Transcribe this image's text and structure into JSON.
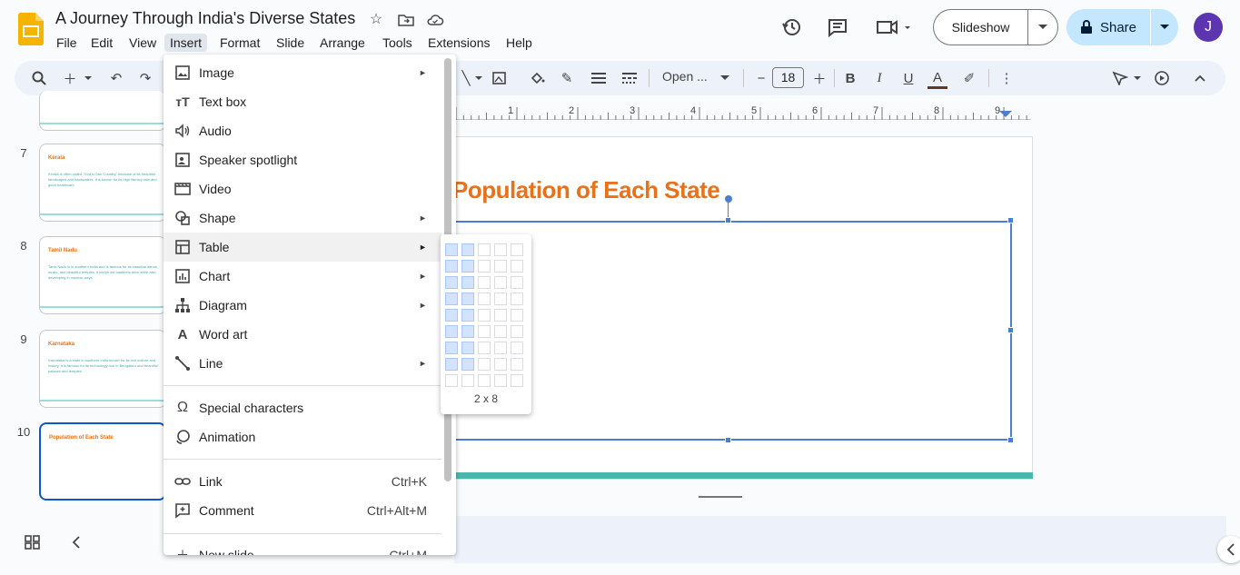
{
  "app": {
    "doc_title": "A Journey Through India's Diverse States",
    "menus": [
      "File",
      "Edit",
      "View",
      "Insert",
      "Format",
      "Slide",
      "Arrange",
      "Tools",
      "Extensions",
      "Help"
    ],
    "active_menu": "Insert",
    "slideshow_label": "Slideshow",
    "share_label": "Share",
    "avatar_initial": "J"
  },
  "toolbar": {
    "font_name": "Open ...",
    "font_size": "18"
  },
  "filmstrip": {
    "slides": [
      {
        "num": "7",
        "title": "Kerala",
        "body": "Kerala is often called \"God's Own Country\" because of its beautiful landscapes and backwaters. It is known for its high literacy rate and good healthcare."
      },
      {
        "num": "8",
        "title": "Tamil Nadu",
        "body": "Tamil Nadu is in southern India and is famous for its classical dance, music, and beautiful temples. It keeps old traditions alive while also developing in modern ways."
      },
      {
        "num": "9",
        "title": "Karnataka",
        "body": "Karnataka is a state in southern India known for its rich culture and history. It is famous for its technology hub in Bengaluru and beautiful palaces and temples."
      },
      {
        "num": "10",
        "title": "Population of Each State",
        "body": ""
      }
    ]
  },
  "ruler": {
    "marks": [
      "1",
      "2",
      "3",
      "4",
      "5",
      "6",
      "7",
      "8",
      "9"
    ]
  },
  "slide": {
    "title": "Population of Each State"
  },
  "insert_menu": {
    "items": [
      {
        "label": "Image",
        "arrow": true
      },
      {
        "label": "Text box"
      },
      {
        "label": "Audio"
      },
      {
        "label": "Speaker spotlight"
      },
      {
        "label": "Video"
      },
      {
        "label": "Shape",
        "arrow": true
      },
      {
        "label": "Table",
        "arrow": true
      },
      {
        "label": "Chart",
        "arrow": true
      },
      {
        "label": "Diagram",
        "arrow": true
      },
      {
        "label": "Word art"
      },
      {
        "label": "Line",
        "arrow": true
      },
      {
        "label": "Special characters"
      },
      {
        "label": "Animation"
      },
      {
        "label": "Link",
        "shortcut": "Ctrl+K"
      },
      {
        "label": "Comment",
        "shortcut": "Ctrl+Alt+M"
      },
      {
        "label": "New slide",
        "shortcut": "Ctrl+M"
      }
    ],
    "arrow_glyph": "►"
  },
  "table_picker": {
    "label": "2 x 8",
    "selected_cols": 2,
    "selected_rows": 8,
    "grid_cols": 5,
    "grid_rows": 9
  },
  "colors": {
    "accent": "#0b57d0",
    "title_orange": "#e8711a",
    "teal_bar": "#4db6ac",
    "share_bg": "#c2e7ff",
    "avatar_bg": "#5e35b1"
  }
}
